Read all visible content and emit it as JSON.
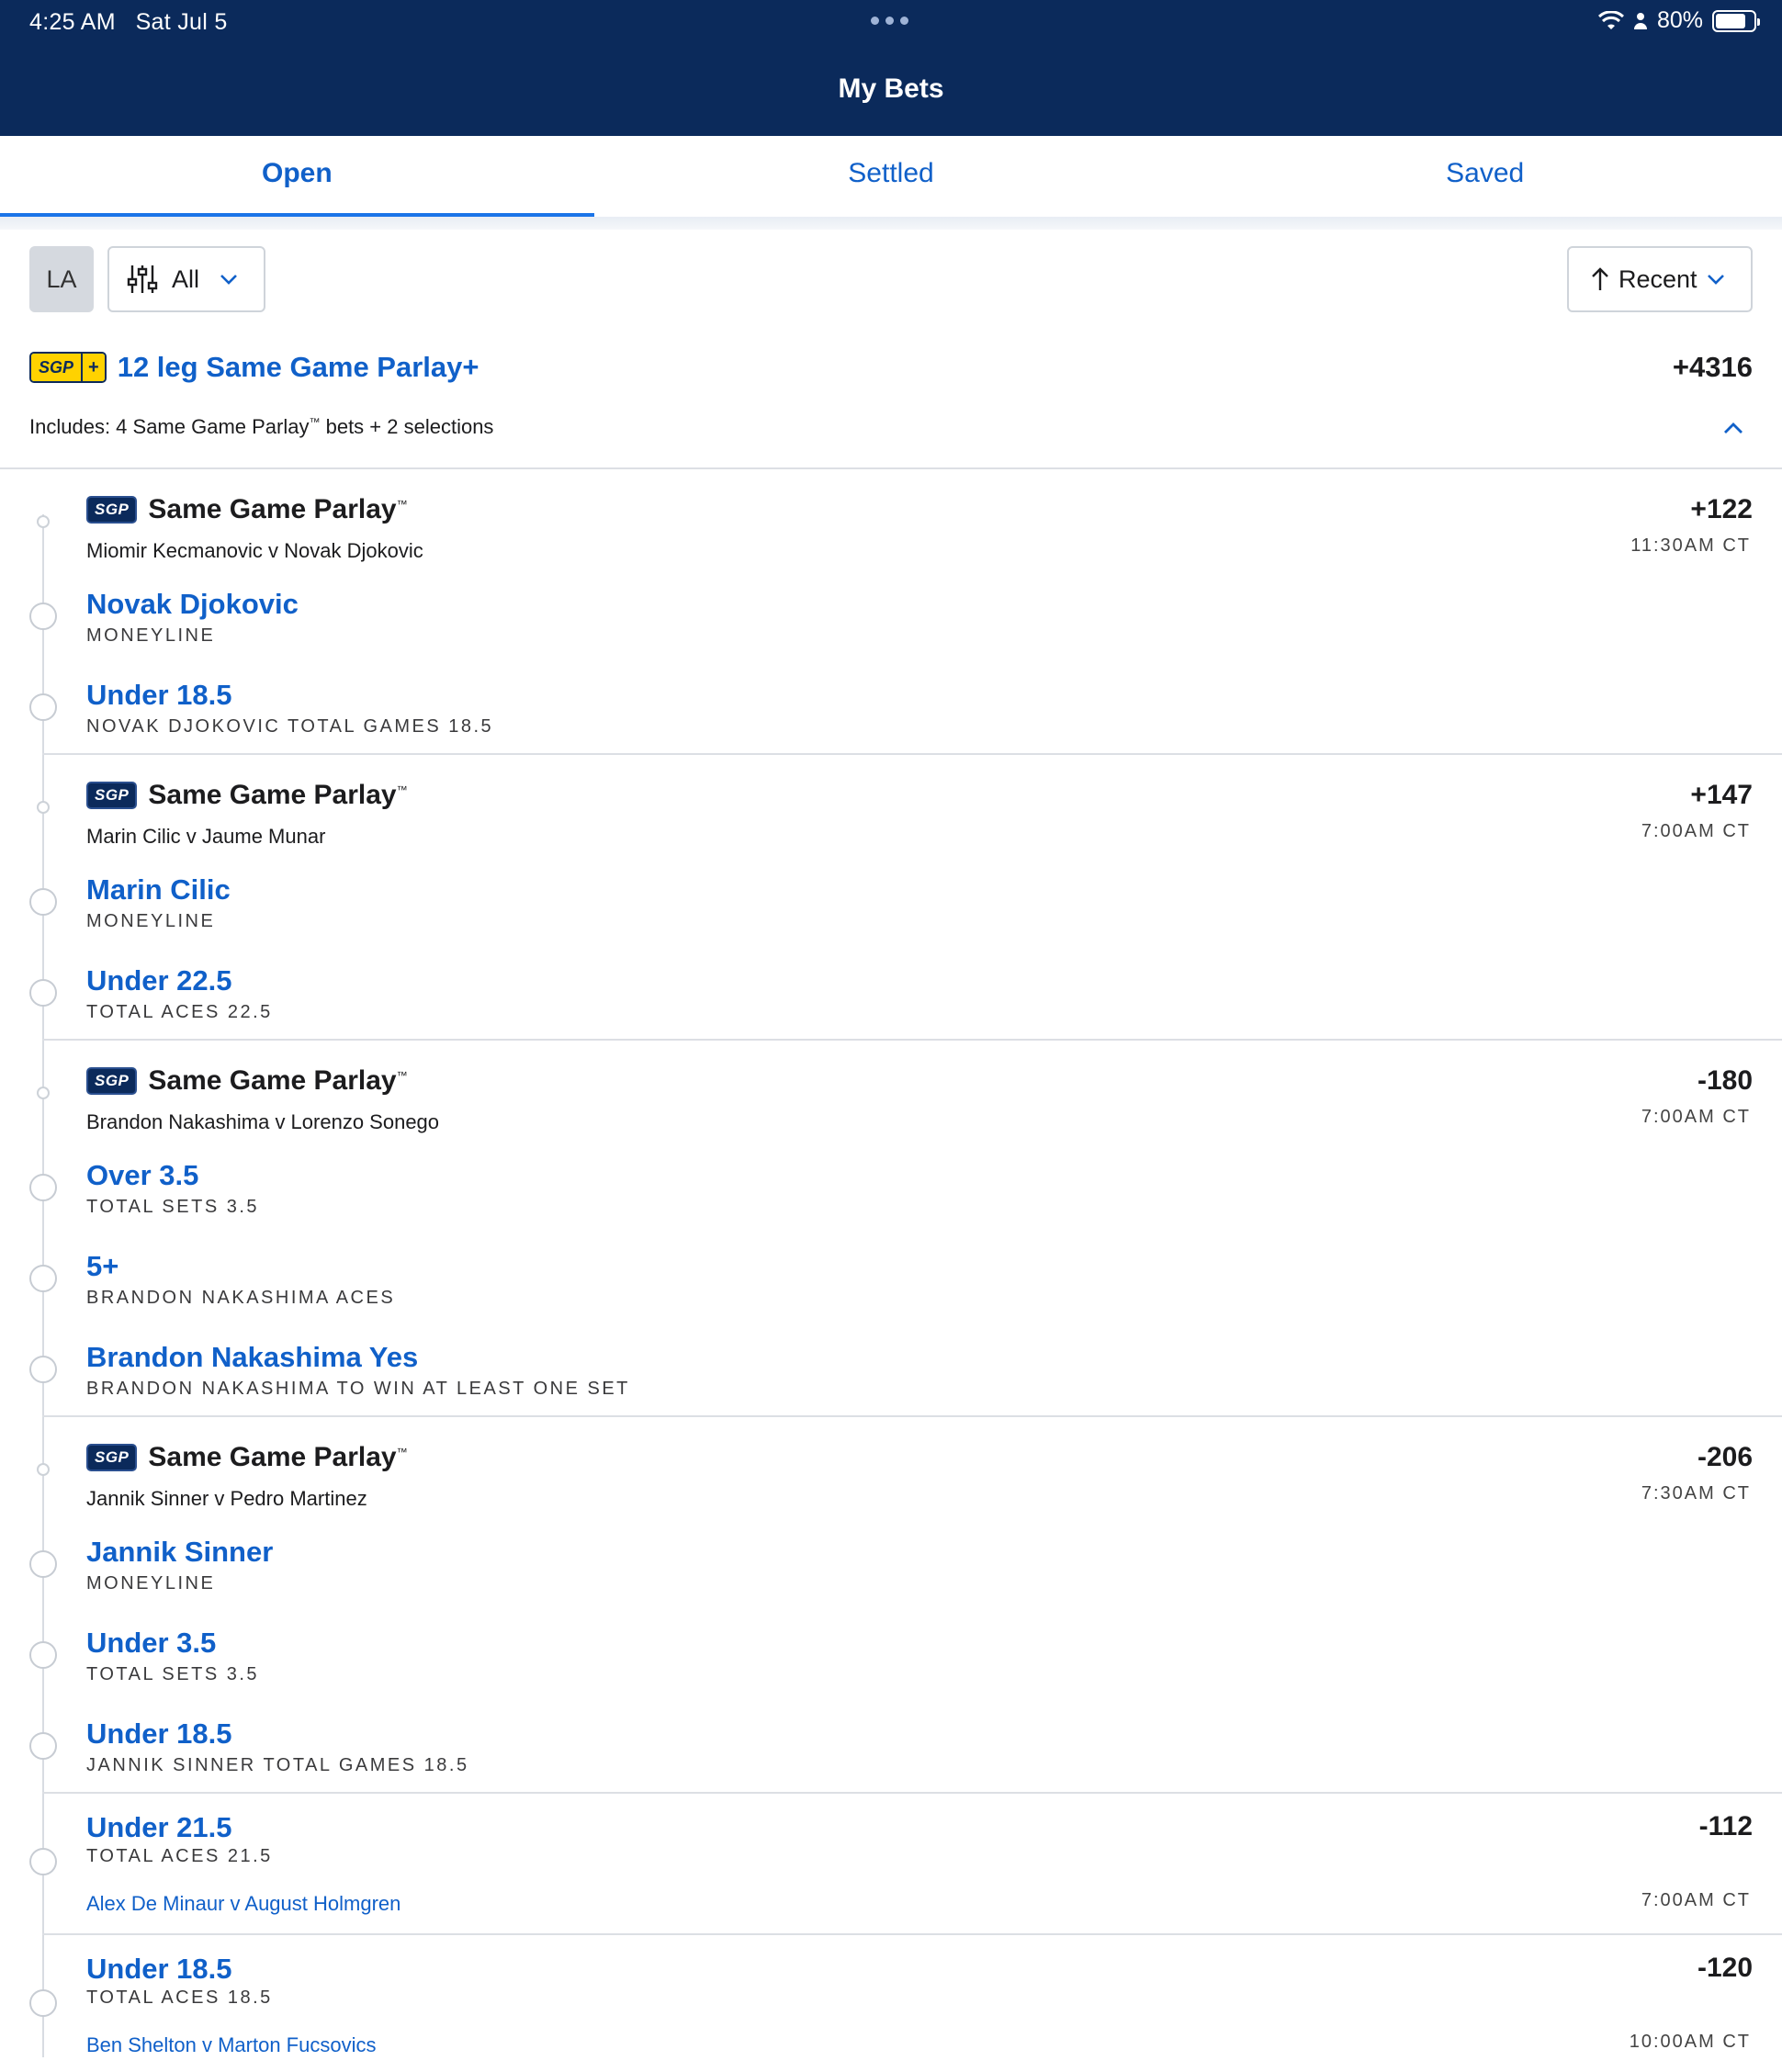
{
  "status": {
    "time": "4:25 AM",
    "date": "Sat Jul 5",
    "battery": "80%",
    "battery_level": 0.8
  },
  "header": {
    "title": "My Bets"
  },
  "tabs": [
    {
      "label": "Open"
    },
    {
      "label": "Settled"
    },
    {
      "label": "Saved"
    }
  ],
  "filters": {
    "region": "LA",
    "type": "All",
    "sort": "Recent"
  },
  "parlay": {
    "badge": "SGP",
    "badge_plus": "+",
    "title": "12 leg Same Game Parlay+",
    "odds": "+4316",
    "includes_prefix": "Includes: 4 Same Game Parlay",
    "includes_tm": "™",
    "includes_suffix": " bets + 2 selections"
  },
  "sgp_title": "Same Game Parlay",
  "sgp_tm": "™",
  "groups": [
    {
      "match": "Miomir Kecmanovic v Novak Djokovic",
      "odds": "+122",
      "time": "11:30AM CT",
      "selections": [
        {
          "name": "Novak Djokovic",
          "market": "MONEYLINE"
        },
        {
          "name": "Under 18.5",
          "market": "NOVAK DJOKOVIC TOTAL GAMES 18.5"
        }
      ]
    },
    {
      "match": "Marin Cilic v Jaume Munar",
      "odds": "+147",
      "time": "7:00AM CT",
      "selections": [
        {
          "name": "Marin Cilic",
          "market": "MONEYLINE"
        },
        {
          "name": "Under 22.5",
          "market": "TOTAL ACES 22.5"
        }
      ]
    },
    {
      "match": "Brandon Nakashima v Lorenzo Sonego",
      "odds": "-180",
      "time": "7:00AM CT",
      "selections": [
        {
          "name": "Over 3.5",
          "market": "TOTAL SETS 3.5"
        },
        {
          "name": "5+",
          "market": "BRANDON NAKASHIMA ACES"
        },
        {
          "name": "Brandon Nakashima Yes",
          "market": "BRANDON NAKASHIMA TO WIN AT LEAST ONE SET"
        }
      ]
    },
    {
      "match": "Jannik Sinner v Pedro Martinez",
      "odds": "-206",
      "time": "7:30AM CT",
      "selections": [
        {
          "name": "Jannik Sinner",
          "market": "MONEYLINE"
        },
        {
          "name": "Under 3.5",
          "market": "TOTAL SETS 3.5"
        },
        {
          "name": "Under 18.5",
          "market": "JANNIK SINNER TOTAL GAMES 18.5"
        }
      ]
    }
  ],
  "singles": [
    {
      "name": "Under 21.5",
      "market": "TOTAL ACES 21.5",
      "match": "Alex De Minaur v August Holmgren",
      "odds": "-112",
      "time": "7:00AM CT"
    },
    {
      "name": "Under 18.5",
      "market": "TOTAL ACES 18.5",
      "match": "Ben Shelton v Marton Fucsovics",
      "odds": "-120",
      "time": "10:00AM CT"
    }
  ]
}
